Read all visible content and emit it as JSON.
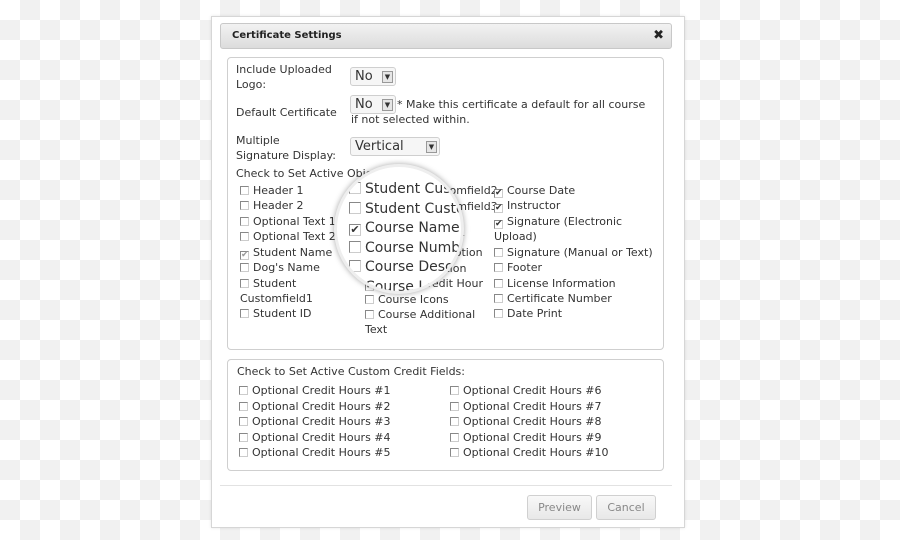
{
  "dialog": {
    "title": "Certificate Settings",
    "close_icon": "close-x-icon"
  },
  "settings": {
    "logo_label": "Include Uploaded Logo:",
    "logo_value": "No",
    "default_label": "Default Certificate",
    "default_value": "No",
    "default_note": "* Make this certificate a default for all course if not selected within.",
    "signature_label": "Multiple Signature Display:",
    "signature_value": "Vertical"
  },
  "objects": {
    "heading": "Check to Set Active Objects:",
    "col1": [
      {
        "label": "Header 1",
        "checked": false
      },
      {
        "label": "Header 2",
        "checked": false
      },
      {
        "label": "Optional Text 1",
        "checked": false
      },
      {
        "label": "Optional Text 2",
        "checked": false
      },
      {
        "label": "Student Name",
        "checked": true
      },
      {
        "label": "Dog's Name",
        "checked": false
      },
      {
        "label": "Student Customfield1",
        "checked": false
      },
      {
        "label": "Student ID",
        "checked": false
      }
    ],
    "col2": [
      {
        "label": "Student Customfield2",
        "checked": false
      },
      {
        "label": "Student Customfield3",
        "checked": false
      },
      {
        "label": "Course Name",
        "checked": true
      },
      {
        "label": "Course Number",
        "checked": false
      },
      {
        "label": "Course Description",
        "checked": false
      },
      {
        "label": "Course Location",
        "checked": true
      },
      {
        "label": "Course Credit Hour",
        "checked": true
      },
      {
        "label": "Course Icons",
        "checked": false
      },
      {
        "label": "Course Additional Text",
        "checked": false
      }
    ],
    "col3": [
      {
        "label": "Course Date",
        "checked": true
      },
      {
        "label": "Instructor",
        "checked": true
      },
      {
        "label": "Signature (Electronic Upload)",
        "checked": true
      },
      {
        "label": "Signature (Manual or Text)",
        "checked": false
      },
      {
        "label": "Footer",
        "checked": false
      },
      {
        "label": "License Information",
        "checked": false
      },
      {
        "label": "Certificate Number",
        "checked": false
      },
      {
        "label": "Date Print",
        "checked": false
      }
    ]
  },
  "credits": {
    "heading": "Check to Set Active Custom Credit Fields:",
    "items": [
      "Optional Credit Hours #1",
      "Optional Credit Hours #2",
      "Optional Credit Hours #3",
      "Optional Credit Hours #4",
      "Optional Credit Hours #5",
      "Optional Credit Hours #6",
      "Optional Credit Hours #7",
      "Optional Credit Hours #8",
      "Optional Credit Hours #9",
      "Optional Credit Hours #10"
    ]
  },
  "buttons": {
    "preview": "Preview",
    "cancel": "Cancel"
  }
}
